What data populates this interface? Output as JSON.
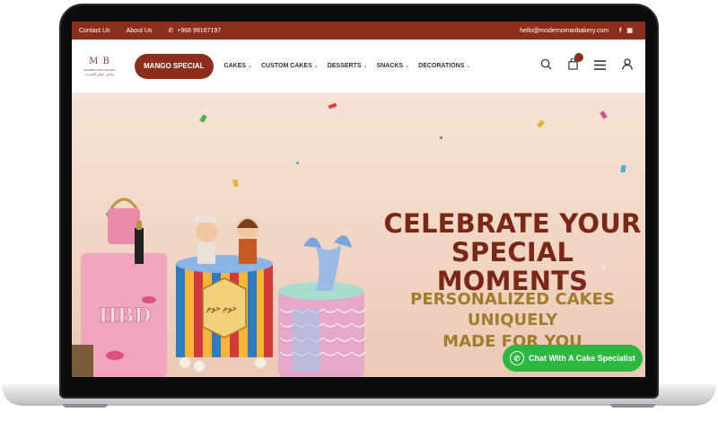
{
  "topbar": {
    "contact": "Contact Us",
    "about": "About Us",
    "phone": "+968 99167197",
    "email": "hello@modernomanbakery.com",
    "facebook_icon": "f",
    "instagram_icon": "▣"
  },
  "header": {
    "logo_mark": "M B",
    "logo_sub": "MODERN OMAN BAKERY",
    "logo_ar": "مخابز عمان الحديث",
    "cta": "MANGO SPECIAL",
    "nav": [
      {
        "label": "CAKES"
      },
      {
        "label": "CUSTOM CAKES"
      },
      {
        "label": "DESSERTS"
      },
      {
        "label": "SNACKS"
      },
      {
        "label": "DECORATIONS"
      }
    ],
    "icons": [
      "search-icon",
      "cart-icon",
      "menu-icon",
      "user-icon"
    ]
  },
  "hero": {
    "headline_1": "CELEBRATE YOUR",
    "headline_2": "SPECIAL MOMENTS",
    "sub_1": "PERSONALIZED CAKES UNIQUELY",
    "sub_2": "MADE FOR YOU",
    "cake_text_1": "HBD",
    "cake_text_2": "حوم حوم",
    "next_arrow": "›"
  },
  "chat": {
    "label": "Chat With A Cake Specialist",
    "icon": "whatsapp-icon"
  },
  "colors": {
    "brand": "#8b2f1c",
    "headline": "#7b2718",
    "sub": "#a37b2d",
    "whatsapp": "#2db842"
  }
}
